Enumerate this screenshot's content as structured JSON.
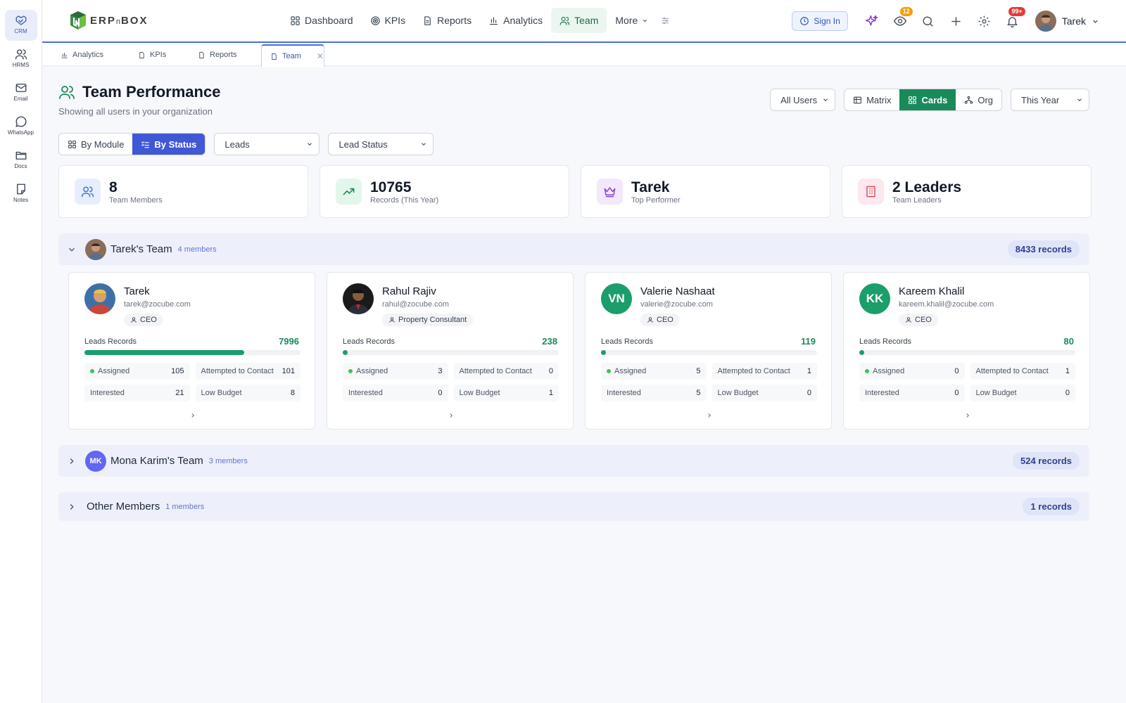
{
  "rail": [
    {
      "label": "CRM",
      "icon": "handshake-icon",
      "active": true
    },
    {
      "label": "HRMS",
      "icon": "users-icon"
    },
    {
      "label": "Email",
      "icon": "mail-icon"
    },
    {
      "label": "WhatsApp",
      "icon": "chat-icon"
    },
    {
      "label": "Docs",
      "icon": "folder-icon"
    },
    {
      "label": "Notes",
      "icon": "note-icon"
    }
  ],
  "header": {
    "logo_main": "ERP",
    "logo_mid": "n",
    "logo_end": "BOX",
    "nav": [
      {
        "label": "Dashboard"
      },
      {
        "label": "KPIs"
      },
      {
        "label": "Reports"
      },
      {
        "label": "Analytics"
      },
      {
        "label": "Team",
        "active": true
      },
      {
        "label": "More"
      }
    ],
    "sign_in": "Sign In",
    "eye_badge": "12",
    "bell_badge": "99+",
    "user_name": "Tarek"
  },
  "tabs": [
    {
      "label": "Analytics"
    },
    {
      "label": "KPIs"
    },
    {
      "label": "Reports"
    },
    {
      "label": "Team",
      "active": true
    }
  ],
  "page": {
    "title": "Team Performance",
    "subtitle": "Showing all users in your organization",
    "user_filter": "All Users",
    "view_modes": [
      "Matrix",
      "Cards",
      "Org"
    ],
    "period": "This Year",
    "group_modes": [
      "By Module",
      "By Status"
    ],
    "module_select": "Leads",
    "status_select": "Lead Status"
  },
  "stats": [
    {
      "value": "8",
      "label": "Team Members",
      "color": "#3b6fd9"
    },
    {
      "value": "10765",
      "label": "Records (This Year)",
      "color": "#1a8a5a"
    },
    {
      "value": "Tarek",
      "label": "Top Performer",
      "color": "#8b3fc9"
    },
    {
      "value": "2 Leaders",
      "label": "Team Leaders",
      "color": "#e04f5f"
    }
  ],
  "teams": [
    {
      "name": "Tarek's Team",
      "count": "4 members",
      "records": "8433 records",
      "expanded": true
    },
    {
      "name": "Mona Karim's Team",
      "initials": "MK",
      "count": "3 members",
      "records": "524 records"
    },
    {
      "name": "Other Members",
      "count": "1 members",
      "records": "1 records"
    }
  ],
  "members": [
    {
      "name": "Tarek",
      "email": "tarek@zocube.com",
      "role": "CEO",
      "records_label": "Leads Records",
      "records": "7996",
      "progress": 0.74,
      "stats": [
        {
          "k": "Assigned",
          "v": "105",
          "dot": true
        },
        {
          "k": "Attempted to Contact",
          "v": "101"
        },
        {
          "k": "Interested",
          "v": "21"
        },
        {
          "k": "Low Budget",
          "v": "8"
        }
      ]
    },
    {
      "name": "Rahul Rajiv",
      "email": "rahul@zocube.com",
      "role": "Property Consultant",
      "records_label": "Leads Records",
      "records": "238",
      "progress": 0.02,
      "stats": [
        {
          "k": "Assigned",
          "v": "3",
          "dot": true
        },
        {
          "k": "Attempted to Contact",
          "v": "0"
        },
        {
          "k": "Interested",
          "v": "0"
        },
        {
          "k": "Low Budget",
          "v": "1"
        }
      ]
    },
    {
      "name": "Valerie Nashaat",
      "initials": "VN",
      "email": "valerie@zocube.com",
      "role": "CEO",
      "records_label": "Leads Records",
      "records": "119",
      "progress": 0.01,
      "stats": [
        {
          "k": "Assigned",
          "v": "5",
          "dot": true
        },
        {
          "k": "Attempted to Contact",
          "v": "1"
        },
        {
          "k": "Interested",
          "v": "5"
        },
        {
          "k": "Low Budget",
          "v": "0"
        }
      ]
    },
    {
      "name": "Kareem Khalil",
      "initials": "KK",
      "email": "kareem.khalil@zocube.com",
      "role": "CEO",
      "records_label": "Leads Records",
      "records": "80",
      "progress": 0.005,
      "stats": [
        {
          "k": "Assigned",
          "v": "0",
          "dot": true
        },
        {
          "k": "Attempted to Contact",
          "v": "1"
        },
        {
          "k": "Interested",
          "v": "0"
        },
        {
          "k": "Low Budget",
          "v": "0"
        }
      ]
    }
  ]
}
